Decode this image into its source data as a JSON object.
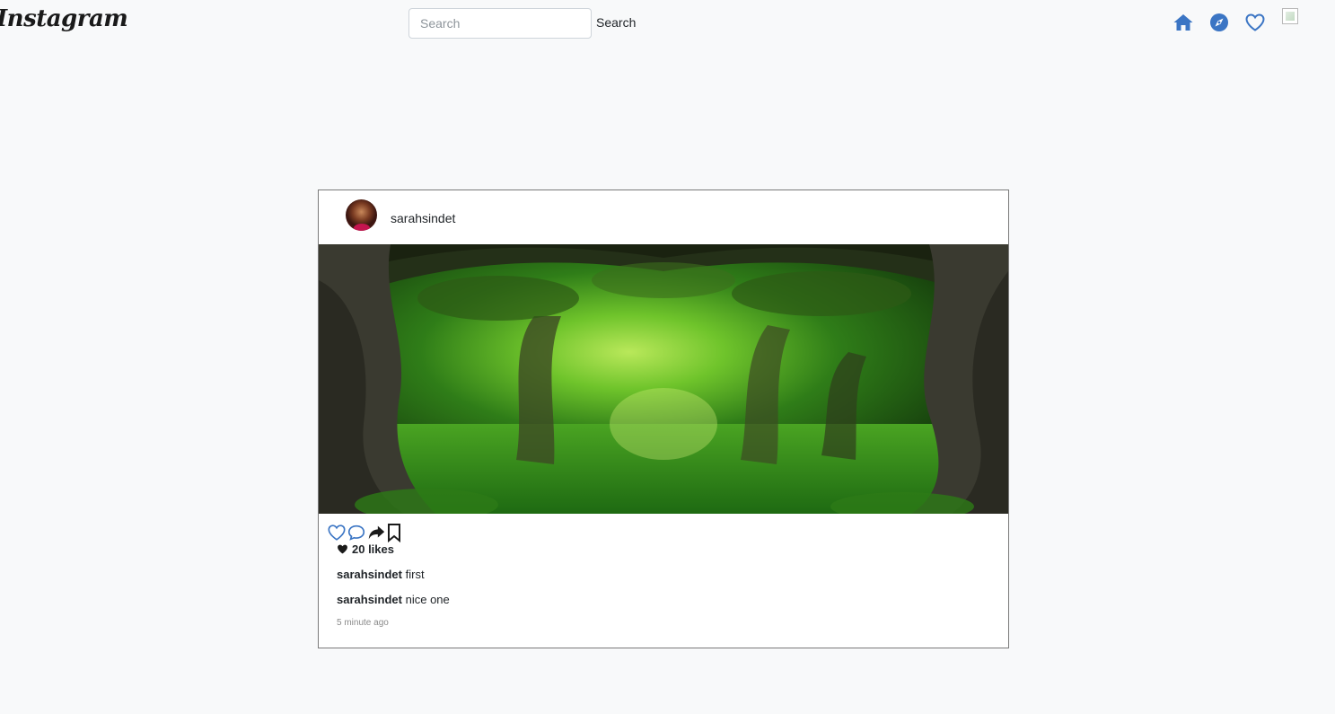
{
  "navbar": {
    "brand": "Instagram",
    "search": {
      "placeholder": "Search",
      "value": "",
      "button_label": "Search"
    },
    "icons": [
      "home-icon",
      "explore-icon",
      "heart-icon",
      "profile-avatar-image"
    ],
    "accent_color": "#3b75c4"
  },
  "post": {
    "username": "sarahsindet",
    "image_subject": "",
    "actions": [
      "like-icon",
      "comment-icon",
      "share-icon",
      "bookmark-icon"
    ],
    "likes_label": "20 likes",
    "comments": [
      {
        "user": "sarahsindet",
        "text": "first"
      },
      {
        "user": "sarahsindet",
        "text": "nice one"
      }
    ],
    "timestamp": "5 minute ago"
  }
}
